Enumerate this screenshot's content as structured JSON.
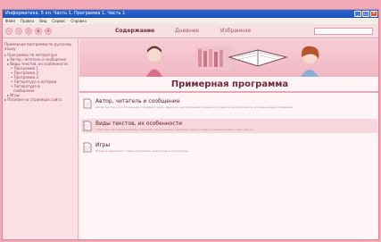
{
  "window": {
    "title": "Информатика. 5 кл. Часть 1. Программа 1. Часть 1",
    "buttons": {
      "minimize": "_",
      "maximize": "□",
      "close": "×"
    }
  },
  "menu": [
    "Файл",
    "Правка",
    "Вид",
    "Сервис",
    "Справка"
  ],
  "toolbar": {
    "tabs": [
      {
        "label": "Содержание",
        "active": true
      },
      {
        "label": "Дневник",
        "active": false
      },
      {
        "label": "Избранное",
        "active": false
      }
    ],
    "search": {
      "placeholder": "",
      "value": ""
    }
  },
  "sidebar": {
    "header": "Примерная программа по русскому языку",
    "items": [
      "Программа по литературе",
      "Автор, читатель и сообщение",
      "Виды текстов, их особенности",
      "Программа 1",
      "Программа 2",
      "Программа 3",
      "Литература и история",
      "Литература и",
      "сообщение",
      "Игры",
      "Пособие на страницах сайта"
    ]
  },
  "main": {
    "title": "Примерная программа",
    "entries": [
      {
        "title": "Автор, читатель и сообщение",
        "desc": "Автор текста и его отношение к предмету речи, адресат и цели общения; речевая ситуация и её компоненты, основные виды сообщений"
      },
      {
        "title": "Виды текстов, их особенности",
        "desc": "Типы текстов: повествование, описание, рассуждение; признаки текста, тема и основная мысль, план текста"
      },
      {
        "title": "Игры",
        "desc": "Игровые задания по темам программы, викторины и кроссворды"
      }
    ]
  },
  "colors": {
    "background": "#f2a9b6",
    "titlebar": "#1c4fb6",
    "accent": "#6e2a3b"
  }
}
